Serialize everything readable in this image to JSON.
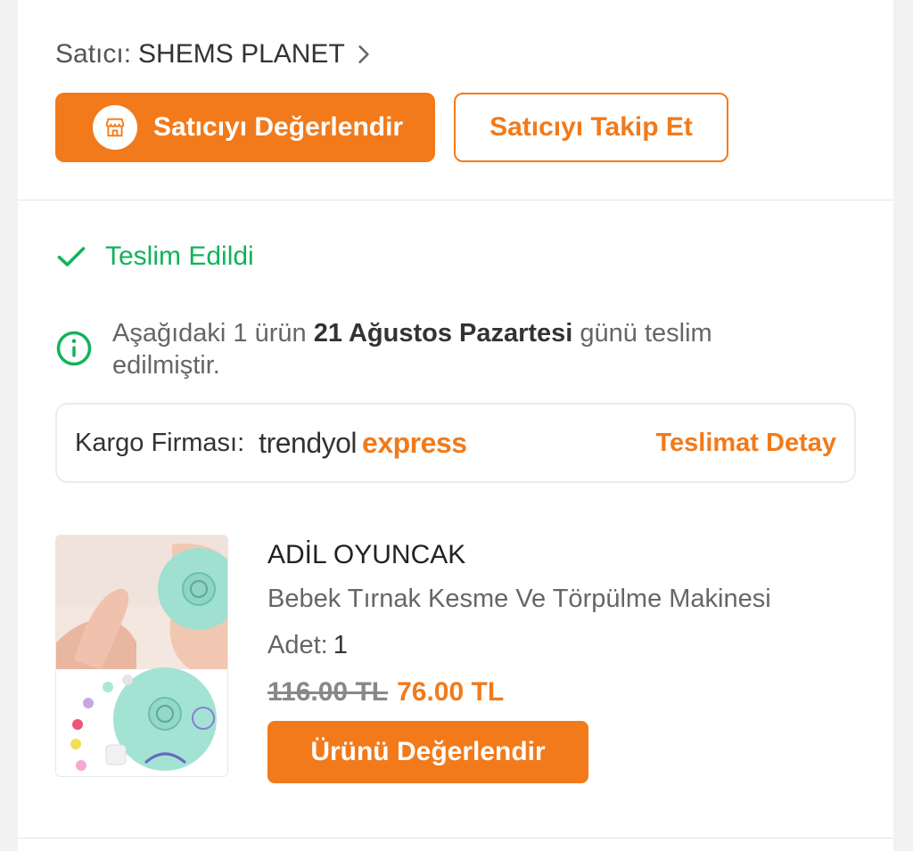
{
  "seller": {
    "label": "Satıcı:",
    "name": "SHEMS PLANET",
    "rate_button": "Satıcıyı Değerlendir",
    "follow_button": "Satıcıyı Takip Et"
  },
  "delivery": {
    "status": "Teslim Edildi",
    "info_prefix": "Aşağıdaki 1 ürün ",
    "info_date": "21 Ağustos Pazartesi",
    "info_suffix": " günü teslim edilmiştir.",
    "cargo_label": "Kargo Firması:",
    "cargo_logo_part1": "trendyol",
    "cargo_logo_part2": "express",
    "detail_link": "Teslimat Detay"
  },
  "product": {
    "brand": "ADİL OYUNCAK",
    "name": "Bebek Tırnak Kesme Ve Törpülme Makinesi",
    "qty_label": "Adet:",
    "qty_value": "1",
    "old_price": "116.00 TL",
    "new_price": "76.00 TL",
    "rate_button": "Ürünü Değerlendir"
  },
  "colors": {
    "accent": "#f27a1a",
    "success": "#10b35a"
  }
}
